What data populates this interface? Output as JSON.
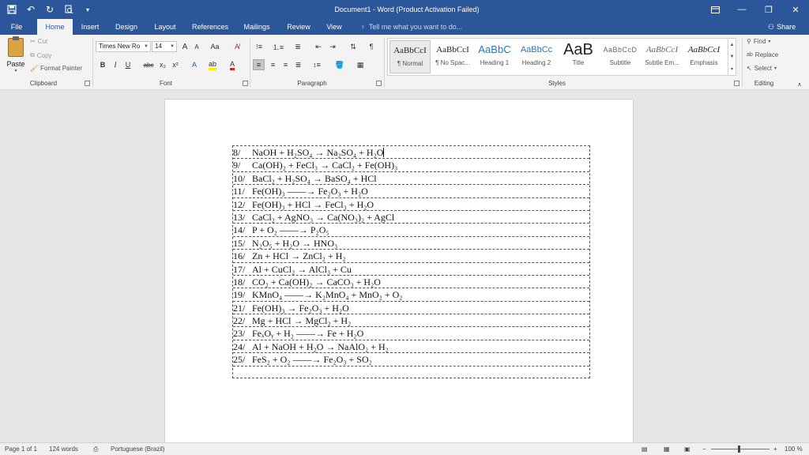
{
  "window": {
    "title": "Document1 - Word (Product Activation Failed)"
  },
  "tabs": [
    "File",
    "Home",
    "Insert",
    "Design",
    "Layout",
    "References",
    "Mailings",
    "Review",
    "View"
  ],
  "tell_me": "Tell me what you want to do...",
  "share_label": "Share",
  "clipboard": {
    "paste": "Paste",
    "cut": "Cut",
    "copy": "Copy",
    "format_painter": "Format Painter",
    "label": "Clipboard"
  },
  "font": {
    "name": "Times New Ro",
    "size": "14",
    "label": "Font",
    "grow": "A",
    "shrink": "A",
    "case": "Aa",
    "bold": "B",
    "italic": "I",
    "underline": "U",
    "strike": "abc",
    "subscript": "x₂",
    "superscript": "x²"
  },
  "paragraph": {
    "label": "Paragraph"
  },
  "styles": {
    "label": "Styles",
    "items": [
      {
        "preview": "AaBbCcI",
        "name": "¶ Normal"
      },
      {
        "preview": "AaBbCcI",
        "name": "¶ No Spac..."
      },
      {
        "preview": "AaBbC",
        "name": "Heading 1"
      },
      {
        "preview": "AaBbCc",
        "name": "Heading 2"
      },
      {
        "preview": "AaB",
        "name": "Title"
      },
      {
        "preview": "AaBbCcD",
        "name": "Subtitle"
      },
      {
        "preview": "AaBbCcI",
        "name": "Subtle Em..."
      },
      {
        "preview": "AaBbCcI",
        "name": "Emphasis"
      }
    ]
  },
  "editing": {
    "find": "Find",
    "replace": "Replace",
    "select": "Select",
    "label": "Editing"
  },
  "document": {
    "rows": [
      {
        "num": "8/",
        "eq": "NaOH  +   H₂SO₄   →   Na₂SO₄  +   H₂O"
      },
      {
        "num": "9/",
        "eq": "Ca(OH)₂  +   FeCl₃   →   CaCl₂  +  Fe(OH)₃"
      },
      {
        "num": "10/",
        "eq": "BaCl₂  +   H₂SO₄    →  BaSO₄  +  HCl"
      },
      {
        "num": "11/",
        "eq": "Fe(OH)₃   ——→    Fe₂O₃  +   H₂O"
      },
      {
        "num": "12/",
        "eq": "Fe(OH)₃  +   HCl    →  FeCl₃  +   H₂O"
      },
      {
        "num": "13/",
        "eq": "CaCl₂  +   AgNO₃   →   Ca(NO₃)₂  +  AgCl"
      },
      {
        "num": "14/",
        "eq": "P  +   O₂   ——→      P₂O₅"
      },
      {
        "num": "15/",
        "eq": "N₂O₅  +   H₂O    →   HNO₃"
      },
      {
        "num": "16/",
        "eq": "Zn  +    HCl  →     ZnCl₂  +   H₂"
      },
      {
        "num": "17/",
        "eq": "Al   +   CuCl₂      → AlCl₃  +    Cu"
      },
      {
        "num": "18/",
        "eq": "CO₂  +    Ca(OH)₂     →  CaCO₃  +    H₂O"
      },
      {
        "num": "19/",
        "eq": "KMnO₄      ——→   K₂MnO₄  +   MnO₂  +  O₂"
      },
      {
        "num": "21/",
        "eq": "Fe(OH)₃   →  Fe₂O₃    +    H₂O"
      },
      {
        "num": "22/",
        "eq": "Mg   + HCl   →    MgCl₂   +  H₂"
      },
      {
        "num": "23/",
        "eq": "FeₓOᵧ   +  H₂        ——→   Fe   +    H₂O"
      },
      {
        "num": "24/",
        "eq": "Al  +  NaOH  + H₂O   →  NaAlO₂   + H₂"
      },
      {
        "num": "25/",
        "eq": "FeS₂   + O₂    ——→     Fe₂O₃  +   SO₂"
      },
      {
        "num": "",
        "eq": ""
      }
    ]
  },
  "status": {
    "page": "Page 1 of 1",
    "words": "124 words",
    "language": "Portuguese (Brazil)",
    "zoom": "100 %"
  }
}
